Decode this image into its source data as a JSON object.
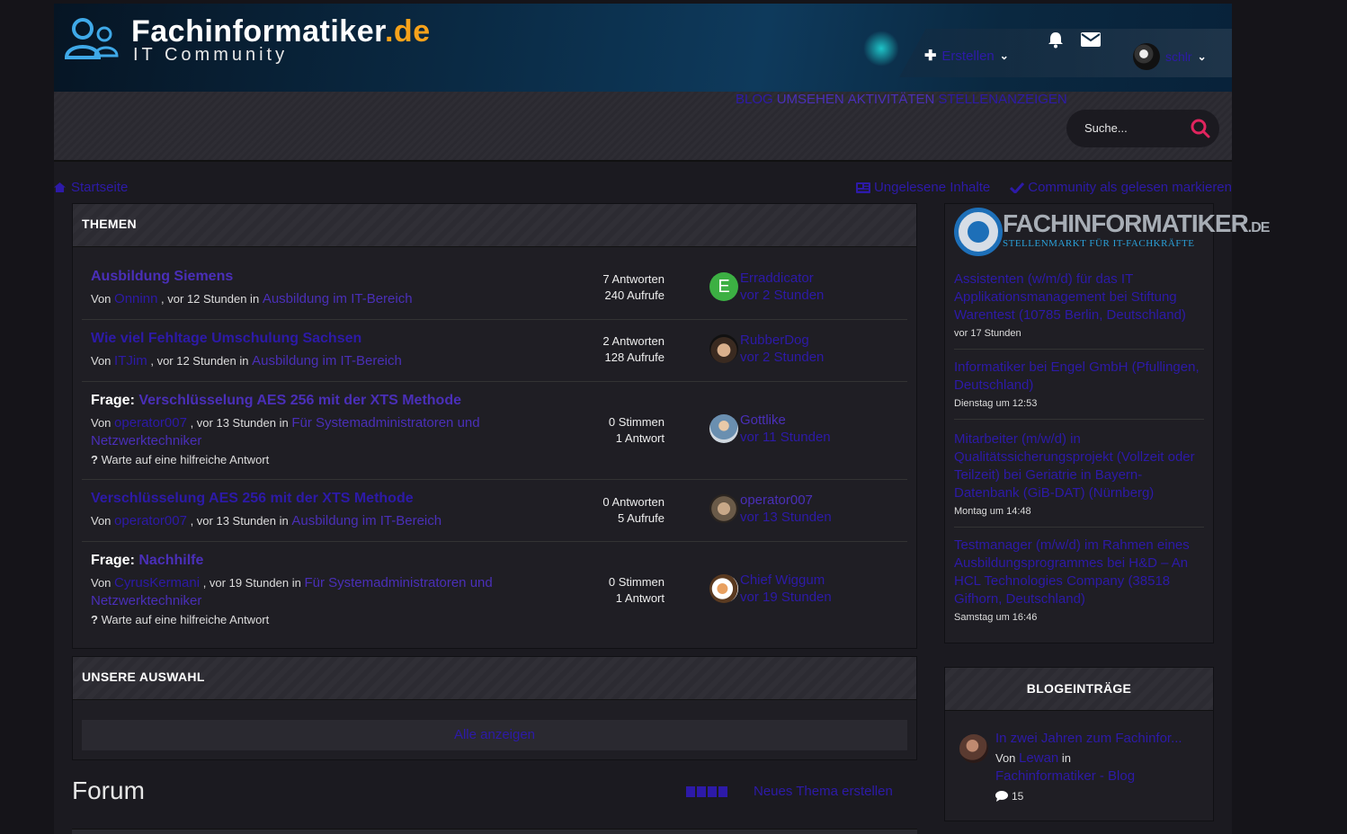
{
  "header": {
    "site_title": "Fachinformatiker",
    "site_tld": ".de",
    "site_subtitle": "IT Community",
    "create_label": "Erstellen",
    "username": "schlr"
  },
  "nav": {
    "items": [
      "BLOG",
      "UMSEHEN",
      "AKTIVITÄTEN",
      "STELLENANZEIGEN"
    ]
  },
  "search": {
    "placeholder": "Suche..."
  },
  "breadcrumb": {
    "home": "Startseite"
  },
  "actions": {
    "unread": "Ungelesene Inhalte",
    "mark_read": "Community als gelesen markieren"
  },
  "topics": {
    "heading": "THEMEN",
    "items": [
      {
        "prefix": "",
        "title": "Ausbildung Siemens",
        "by": "Von",
        "author": "Onninn",
        "when": ", vor 12 Stunden in",
        "forum": "Ausbildung im IT-Bereich",
        "note": "",
        "stat1": "7 Antworten",
        "stat2": "240 Aufrufe",
        "last_user": "Erraddicator",
        "last_time": "vor 2 Stunden"
      },
      {
        "prefix": "",
        "title": "Wie viel Fehltage Umschulung Sachsen",
        "by": "Von",
        "author": "ITJim",
        "when": ", vor 12 Stunden in",
        "forum": "Ausbildung im IT-Bereich",
        "note": "",
        "stat1": "2 Antworten",
        "stat2": "128 Aufrufe",
        "last_user": "RubberDog",
        "last_time": "vor 2 Stunden"
      },
      {
        "prefix": "Frage:",
        "title": "Verschlüsselung AES 256 mit der XTS Methode",
        "by": "Von",
        "author": "operator007",
        "when": ", vor 13 Stunden in",
        "forum": "Für Systemadministratoren und Netzwerktechniker",
        "note": "Warte auf eine hilfreiche Antwort",
        "stat1": "0 Stimmen",
        "stat2": "1 Antwort",
        "last_user": "Gottlike",
        "last_time": "vor 11 Stunden"
      },
      {
        "prefix": "",
        "title": "Verschlüsselung AES 256 mit der XTS Methode",
        "by": "Von",
        "author": "operator007",
        "when": ", vor 13 Stunden in",
        "forum": "Ausbildung im IT-Bereich",
        "note": "",
        "stat1": "0 Antworten",
        "stat2": "5 Aufrufe",
        "last_user": "operator007",
        "last_time": "vor 13 Stunden"
      },
      {
        "prefix": "Frage:",
        "title": "Nachhilfe",
        "by": "Von",
        "author": "CyrusKermani",
        "when": ", vor 19 Stunden in",
        "forum": "Für Systemadministratoren und Netzwerktechniker",
        "note": "Warte auf eine hilfreiche Antwort",
        "stat1": "0 Stimmen",
        "stat2": "1 Antwort",
        "last_user": "Chief Wiggum",
        "last_time": "vor 19 Stunden"
      }
    ],
    "avatar_letter": "E"
  },
  "picks": {
    "heading": "UNSERE AUSWAHL",
    "show_all": "Alle anzeigen"
  },
  "forum": {
    "heading": "Forum",
    "new_topic": "Neues Thema erstellen"
  },
  "jobs": {
    "logo_big": "FACHINFORMATIKER",
    "logo_de": ".DE",
    "logo_small": "STELLENMARKT FÜR IT-FACHKRÄFTE",
    "items": [
      {
        "title": "Assistenten (w/m/d) für das IT Applikationsmanagement bei Stiftung Warentest (10785 Berlin, Deutschland)",
        "date": "vor 17 Stunden"
      },
      {
        "title": "Informatiker bei Engel GmbH (Pfullingen, Deutschland)",
        "date": "Dienstag um 12:53"
      },
      {
        "title": "Mitarbeiter (m/w/d) in Qualitätssicherungsprojekt (Vollzeit oder Teilzeit) bei Geriatrie in Bayern-Datenbank (GiB-DAT) (Nürnberg)",
        "date": "Montag um 14:48"
      },
      {
        "title": "Testmanager (m/w/d) im Rahmen eines Ausbildungsprogrammes bei H&D – An HCL Technologies Company (38518 Gifhorn, Deutschland)",
        "date": "Samstag um 16:46"
      }
    ]
  },
  "blog": {
    "heading": "BLOGEINTRÄGE",
    "title": "In zwei Jahren zum Fachinfor...",
    "by": "Von",
    "author": "Lewan",
    "in": "in",
    "category": "Fachinformatiker - Blog",
    "comments": "15"
  }
}
